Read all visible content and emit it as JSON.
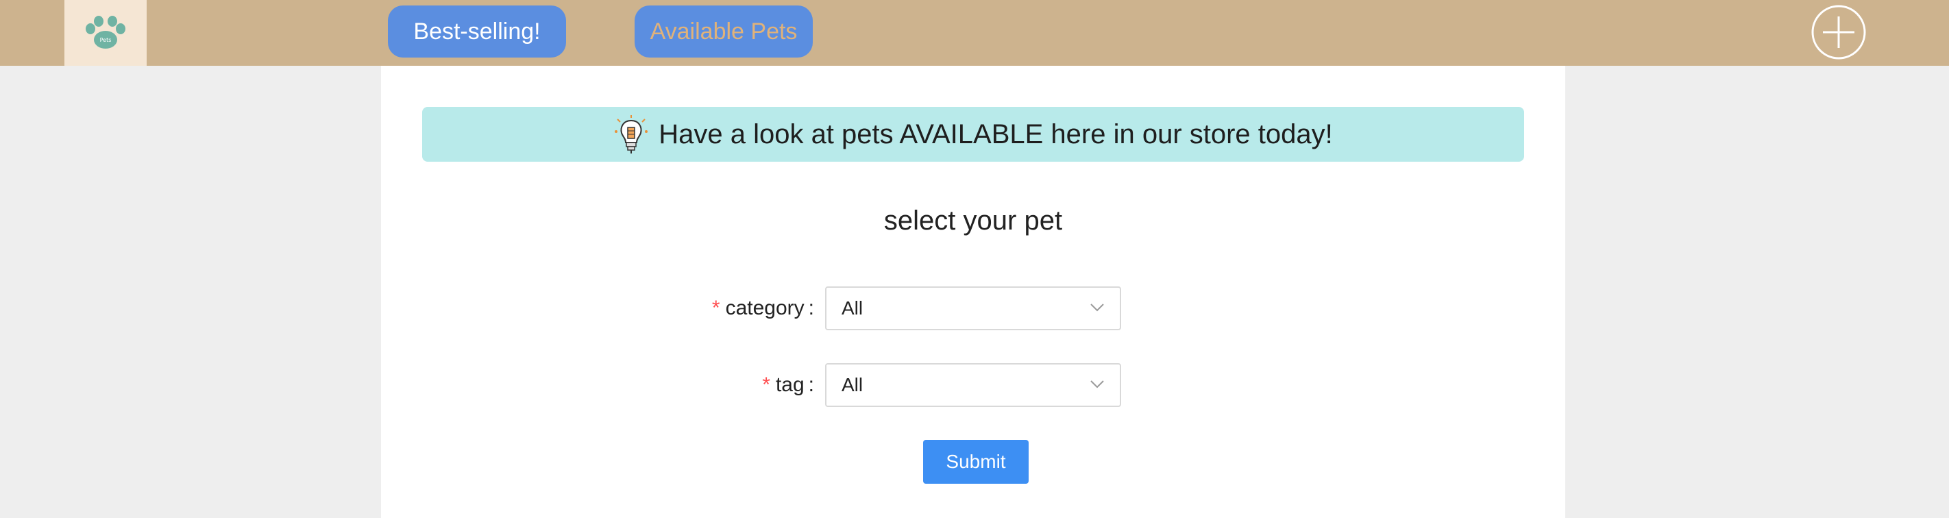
{
  "header": {
    "logo_icon": "paw-logo-icon",
    "logo_text": "Pets",
    "nav": {
      "best_selling_label": "Best-selling!",
      "available_pets_label": "Available Pets"
    },
    "add_icon": "plus-circle-icon"
  },
  "banner": {
    "icon": "lightbulb-icon",
    "text": "Have a look at pets AVAILABLE here in our store today!"
  },
  "form": {
    "title": "select your pet",
    "category": {
      "label": "category",
      "required_mark": "*",
      "colon": ":",
      "value": "All"
    },
    "tag": {
      "label": "tag",
      "required_mark": "*",
      "colon": ":",
      "value": "All"
    },
    "submit_label": "Submit"
  },
  "colors": {
    "topbar": "#cdb38e",
    "nav_button": "#5b8ee0",
    "banner": "#b8eaea",
    "submit": "#3d8ff3",
    "required": "#ff4d4f"
  }
}
